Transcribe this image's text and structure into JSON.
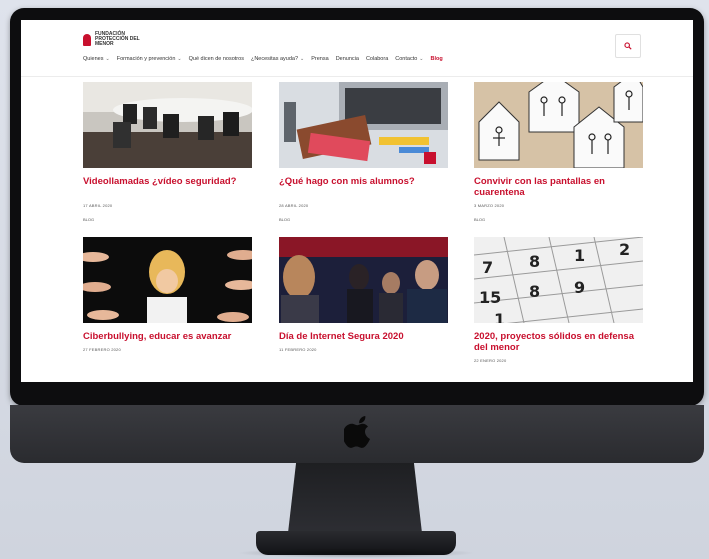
{
  "site": {
    "logo_text": "FUNDACIÓN PROTECCIÓN DEL MENOR",
    "nav": [
      {
        "label": "Quienes",
        "dropdown": true
      },
      {
        "label": "Formación y prevención",
        "dropdown": true
      },
      {
        "label": "Qué dicen de nosotros",
        "dropdown": false
      },
      {
        "label": "¿Necesitas ayuda?",
        "dropdown": true
      },
      {
        "label": "Prensa",
        "dropdown": false
      },
      {
        "label": "Denuncia",
        "dropdown": false
      },
      {
        "label": "Colabora",
        "dropdown": false
      },
      {
        "label": "Contacto",
        "dropdown": true
      },
      {
        "label": "Blog",
        "dropdown": false,
        "highlight": true
      }
    ],
    "search_icon": "search-icon"
  },
  "posts": [
    {
      "title": "Videollamadas ¿vídeo seguridad?",
      "date": "17 ABRIL 2020",
      "tag": "BLOG"
    },
    {
      "title": "¿Qué hago con mis alumnos?",
      "date": "28 ABRIL 2020",
      "tag": "BLOG"
    },
    {
      "title": "Convivir con las pantallas en cuarentena",
      "date": "3 MARZO 2020",
      "tag": "BLOG"
    },
    {
      "title": "Ciberbullying, educar es avanzar",
      "date": "27 FEBRERO 2020",
      "tag": ""
    },
    {
      "title": "Día de Internet Segura 2020",
      "date": "11 FEBRERO 2020",
      "tag": ""
    },
    {
      "title": "2020, proyectos sólidos en defensa del menor",
      "date": "22 ENERO 2020",
      "tag": ""
    }
  ],
  "device": {
    "brand_icon": "apple-logo-icon"
  },
  "colors": {
    "accent": "#c8102e"
  }
}
